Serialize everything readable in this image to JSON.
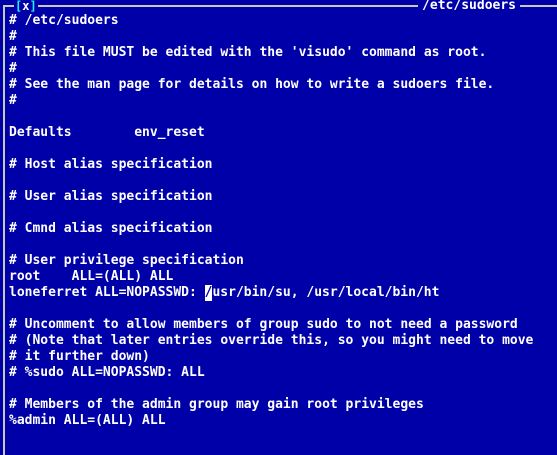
{
  "window": {
    "close_label": "x",
    "title": "/etc/sudoers"
  },
  "editor": {
    "lines": [
      "# /etc/sudoers",
      "#",
      "# This file MUST be edited with the 'visudo' command as root.",
      "#",
      "# See the man page for details on how to write a sudoers file.",
      "#",
      "",
      "Defaults        env_reset",
      "",
      "# Host alias specification",
      "",
      "# User alias specification",
      "",
      "# Cmnd alias specification",
      "",
      "# User privilege specification",
      "root    ALL=(ALL) ALL",
      "loneferret ALL=NOPASSWD: /usr/bin/su, /usr/local/bin/ht",
      "",
      "# Uncomment to allow members of group sudo to not need a password",
      "# (Note that later entries override this, so you might need to move",
      "# it further down)",
      "# %sudo ALL=NOPASSWD: ALL",
      "",
      "# Members of the admin group may gain root privileges",
      "%admin ALL=(ALL) ALL"
    ],
    "cursor_line": 17,
    "cursor_col": 25
  },
  "colors": {
    "background": "#0000a8",
    "text": "#ffffff",
    "frame": "#c7c7c7",
    "close_bracket": "#1ff0ff"
  }
}
